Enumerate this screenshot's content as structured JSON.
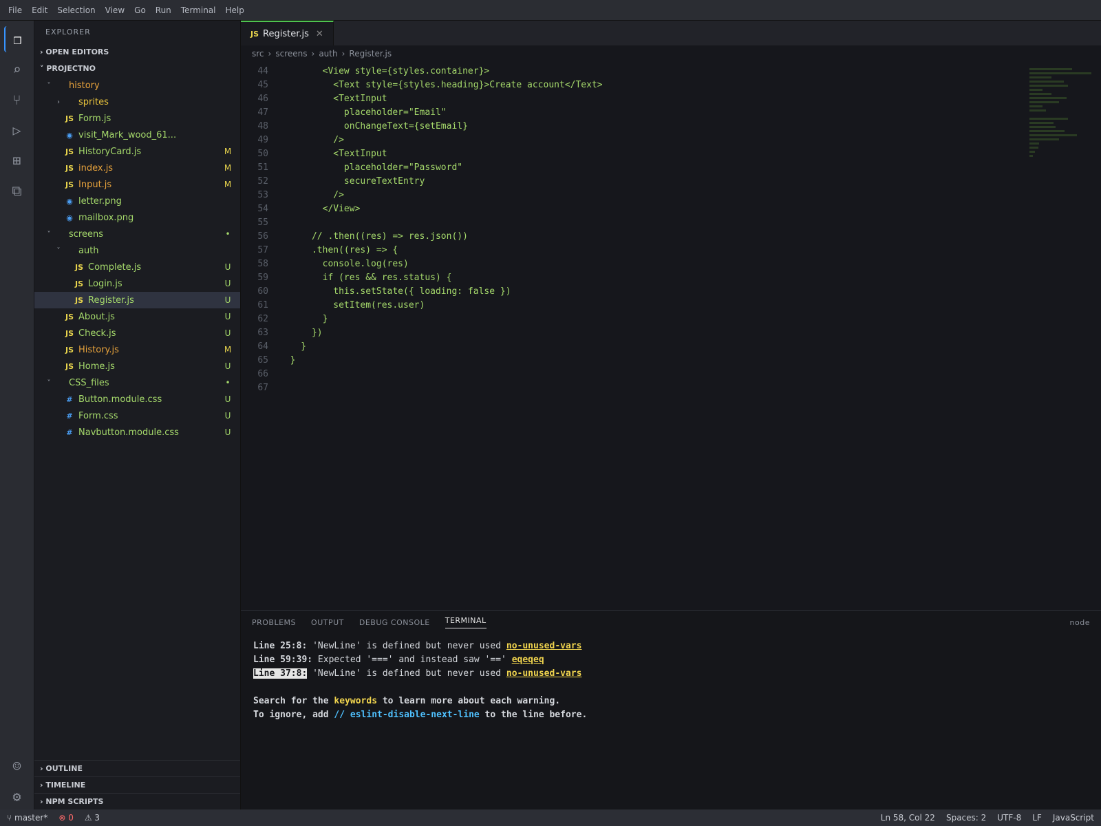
{
  "titlebar": {
    "menus": [
      "File",
      "Edit",
      "Selection",
      "View",
      "Go",
      "Run",
      "Terminal",
      "Help"
    ],
    "title": ""
  },
  "activity": [
    {
      "name": "files-icon",
      "glyph": "❐"
    },
    {
      "name": "search-icon",
      "glyph": "⌕"
    },
    {
      "name": "source-control-icon",
      "glyph": "⑂"
    },
    {
      "name": "run-debug-icon",
      "glyph": "▷"
    },
    {
      "name": "extensions-icon",
      "glyph": "⊞"
    },
    {
      "name": "remote-icon",
      "glyph": "⧉"
    }
  ],
  "sidebar": {
    "title": "EXPLORER",
    "open_editors": "OPEN EDITORS",
    "project": "PROJECTNO",
    "items": [
      {
        "indent": 1,
        "twisty": "˅",
        "icon": "",
        "icon_color": "#e8a33c",
        "name": "history",
        "name_color": "#e8a33c",
        "badge": "",
        "badge_color": ""
      },
      {
        "indent": 2,
        "twisty": "›",
        "icon": "",
        "icon_color": "#9aa0aa",
        "name": "sprites",
        "name_color": "#e8c33c",
        "badge": "",
        "badge_color": ""
      },
      {
        "indent": 2,
        "twisty": "",
        "icon": "JS",
        "icon_color": "#e8d44d",
        "name": "Form.js",
        "name_color": "#a5d96b",
        "badge": "",
        "badge_color": ""
      },
      {
        "indent": 2,
        "twisty": "",
        "icon": "◉",
        "icon_color": "#4a9cf0",
        "name": "visit_Mark_wood_61...",
        "name_color": "#a5d96b",
        "badge": "",
        "badge_color": ""
      },
      {
        "indent": 2,
        "twisty": "",
        "icon": "JS",
        "icon_color": "#e8d44d",
        "name": "HistoryCard.js",
        "name_color": "#a5d96b",
        "badge": "M",
        "badge_color": "#e8d44d"
      },
      {
        "indent": 2,
        "twisty": "",
        "icon": "JS",
        "icon_color": "#e8d44d",
        "name": "index.js",
        "name_color": "#e8a33c",
        "badge": "M",
        "badge_color": "#e8d44d"
      },
      {
        "indent": 2,
        "twisty": "",
        "icon": "JS",
        "icon_color": "#e8d44d",
        "name": "Input.js",
        "name_color": "#e8a33c",
        "badge": "M",
        "badge_color": "#e8d44d"
      },
      {
        "indent": 2,
        "twisty": "",
        "icon": "◉",
        "icon_color": "#4a9cf0",
        "name": "letter.png",
        "name_color": "#a5d96b",
        "badge": "",
        "badge_color": ""
      },
      {
        "indent": 2,
        "twisty": "",
        "icon": "◉",
        "icon_color": "#4a9cf0",
        "name": "mailbox.png",
        "name_color": "#a5d96b",
        "badge": "",
        "badge_color": ""
      },
      {
        "indent": 1,
        "twisty": "˅",
        "icon": "",
        "icon_color": "#9aa0aa",
        "name": "screens",
        "name_color": "#a5d96b",
        "badge": "•",
        "badge_color": "#a5d96b"
      },
      {
        "indent": 2,
        "twisty": "˅",
        "icon": "",
        "icon_color": "#9aa0aa",
        "name": "auth",
        "name_color": "#a5d96b",
        "badge": "",
        "badge_color": ""
      },
      {
        "indent": 3,
        "twisty": "",
        "icon": "JS",
        "icon_color": "#e8d44d",
        "name": "Complete.js",
        "name_color": "#a5d96b",
        "badge": "U",
        "badge_color": "#a5d96b"
      },
      {
        "indent": 3,
        "twisty": "",
        "icon": "JS",
        "icon_color": "#e8d44d",
        "name": "Login.js",
        "name_color": "#a5d96b",
        "badge": "U",
        "badge_color": "#a5d96b"
      },
      {
        "indent": 3,
        "twisty": "",
        "icon": "JS",
        "icon_color": "#e8d44d",
        "name": "Register.js",
        "name_color": "#a5d96b",
        "badge": "U",
        "badge_color": "#a5d96b"
      },
      {
        "indent": 2,
        "twisty": "",
        "icon": "JS",
        "icon_color": "#e8d44d",
        "name": "About.js",
        "name_color": "#a5d96b",
        "badge": "U",
        "badge_color": "#a5d96b"
      },
      {
        "indent": 2,
        "twisty": "",
        "icon": "JS",
        "icon_color": "#e8d44d",
        "name": "Check.js",
        "name_color": "#a5d96b",
        "badge": "U",
        "badge_color": "#a5d96b"
      },
      {
        "indent": 2,
        "twisty": "",
        "icon": "JS",
        "icon_color": "#e8d44d",
        "name": "History.js",
        "name_color": "#e8a33c",
        "badge": "M",
        "badge_color": "#e8d44d"
      },
      {
        "indent": 2,
        "twisty": "",
        "icon": "JS",
        "icon_color": "#e8d44d",
        "name": "Home.js",
        "name_color": "#a5d96b",
        "badge": "U",
        "badge_color": "#a5d96b"
      },
      {
        "indent": 1,
        "twisty": "˅",
        "icon": "",
        "icon_color": "#9aa0aa",
        "name": "CSS_files",
        "name_color": "#a5d96b",
        "badge": "•",
        "badge_color": "#a5d96b"
      },
      {
        "indent": 2,
        "twisty": "",
        "icon": "#",
        "icon_color": "#4a9cf0",
        "name": "Button.module.css",
        "name_color": "#a5d96b",
        "badge": "U",
        "badge_color": "#a5d96b"
      },
      {
        "indent": 2,
        "twisty": "",
        "icon": "#",
        "icon_color": "#4a9cf0",
        "name": "Form.css",
        "name_color": "#a5d96b",
        "badge": "U",
        "badge_color": "#a5d96b"
      },
      {
        "indent": 2,
        "twisty": "",
        "icon": "#",
        "icon_color": "#4a9cf0",
        "name": "Navbutton.module.css",
        "name_color": "#a5d96b",
        "badge": "U",
        "badge_color": "#a5d96b"
      }
    ],
    "footer": [
      "OUTLINE",
      "TIMELINE",
      "NPM SCRIPTS"
    ]
  },
  "tab": {
    "icon": "JS",
    "label": "Register.js"
  },
  "breadcrumb": [
    "src",
    "screens",
    "auth",
    "Register.js"
  ],
  "code_start_line": 44,
  "code_lines": [
    "        <View style={styles.container}>",
    "          <Text style={styles.heading}>Create account</Text>",
    "          <TextInput",
    "            placeholder=\"Email\"",
    "            onChangeText={setEmail}",
    "          />",
    "          <TextInput",
    "            placeholder=\"Password\"",
    "            secureTextEntry",
    "          />",
    "        </View>",
    "",
    "      // .then((res) => res.json())",
    "      .then((res) => {",
    "        console.log(res)",
    "        if (res && res.status) {",
    "          this.setState({ loading: false })",
    "          setItem(res.user)",
    "        }",
    "      })",
    "    }",
    "  }",
    "",
    ""
  ],
  "panel": {
    "tabs": [
      "PROBLEMS",
      "OUTPUT",
      "DEBUG CONSOLE",
      "TERMINAL"
    ],
    "active": "TERMINAL",
    "shell": "node",
    "lines": [
      {
        "prefix": "Line 25:8:",
        "text": "  'NewLine' is defined but never used  ",
        "rule": "no-unused-vars"
      },
      {
        "prefix": "Line 59:39:",
        "text": "  Expected '===' and instead saw '=='  ",
        "rule": "eqeqeq"
      },
      {
        "prefix": "Line 37:8:",
        "text": "  'NewLine' is defined but never used  ",
        "rule": "no-unused-vars"
      }
    ],
    "help1_a": "Search for the ",
    "help1_kw": "keywords",
    "help1_b": " to learn more about each warning.",
    "help2_a": "To ignore, add ",
    "help2_cm": "// eslint-disable-next-line",
    "help2_b": " to the line before."
  },
  "status": {
    "branch": "⑂ master*",
    "errors": "⊗ 0",
    "warnings": "⚠ 3",
    "pos": "Ln 58, Col 22",
    "spaces": "Spaces: 2",
    "enc": "UTF-8",
    "eol": "LF",
    "lang": "JavaScript"
  }
}
